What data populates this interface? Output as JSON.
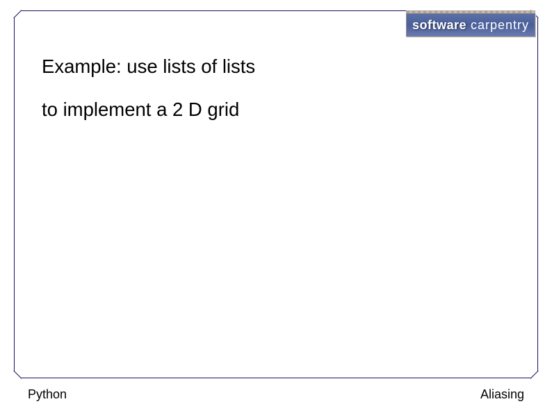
{
  "logo": {
    "word1": "software",
    "word2": "carpentry"
  },
  "content": {
    "line1": "Example: use lists of lists",
    "line2": "to implement a 2 D grid"
  },
  "footer": {
    "left": "Python",
    "right": "Aliasing"
  }
}
